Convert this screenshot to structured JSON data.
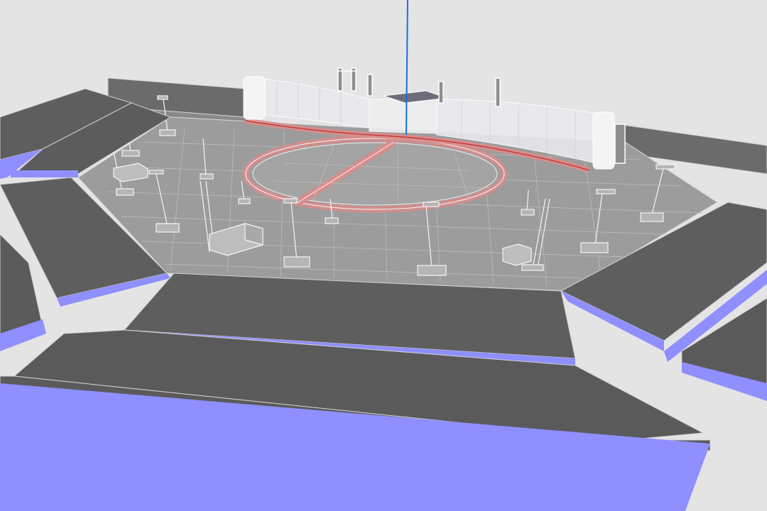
{
  "viewport": {
    "background": "#e4e4e4",
    "colors": {
      "floor": "#9a9a9a",
      "stand_top": "#5e5e5e",
      "stand_face": "#8f8fff",
      "wall": "#6a6a6a",
      "stage_outline": "#d98c8c",
      "stage_fill": "#b99f9f",
      "axis_line": "#1e6fd9",
      "wireframe": "#f2f2f2"
    },
    "objects": {
      "floor": "floor-plane",
      "stage": "runway-stage",
      "screen_wall": "video-screen-wall",
      "towers": "lighting-towers",
      "vehicles": "service-vehicles",
      "stands": "tiered-stands",
      "axis": "z-axis-guide"
    }
  }
}
